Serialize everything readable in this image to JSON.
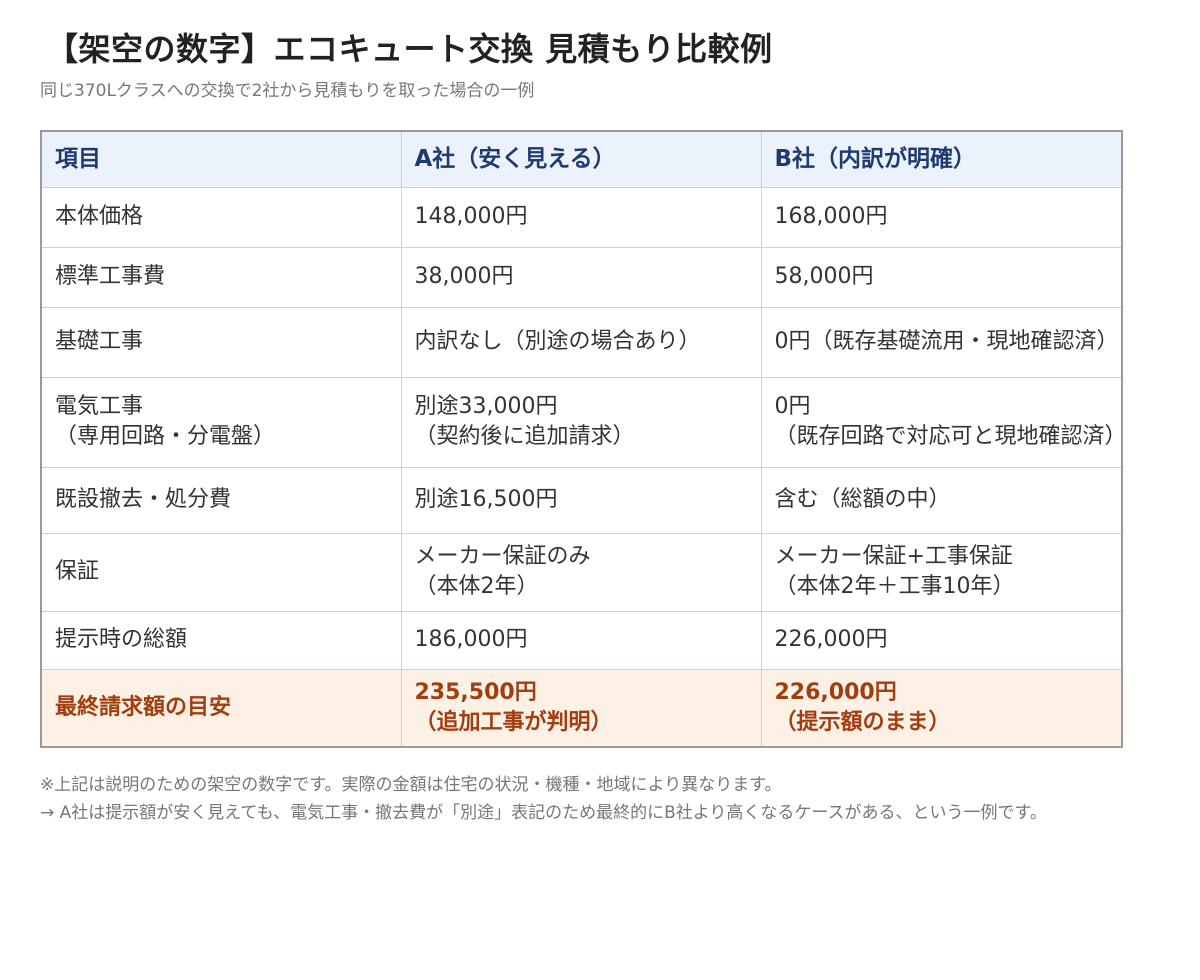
{
  "header": {
    "title": "【架空の数字】エコキュート交換 見積もり比較例",
    "subtitle": "同じ370Lクラスへの交換で2社から見積もりを取った場合の一例"
  },
  "table": {
    "columns": [
      "項目",
      "A社（安く見える）",
      "B社（内訳が明確）"
    ],
    "rows": [
      {
        "item": [
          "本体価格"
        ],
        "a": [
          "148,000円"
        ],
        "b": [
          "168,000円"
        ]
      },
      {
        "item": [
          "標準工事費"
        ],
        "a": [
          "38,000円"
        ],
        "b": [
          "58,000円"
        ]
      },
      {
        "item": [
          "基礎工事"
        ],
        "a": [
          "内訳なし（別途の場合あり）"
        ],
        "b": [
          "0円（既存基礎流用・現地確認済）"
        ]
      },
      {
        "item": [
          "電気工事",
          "（専用回路・分電盤）"
        ],
        "a": [
          "別途33,000円",
          "（契約後に追加請求）"
        ],
        "b": [
          "0円",
          "（既存回路で対応可と現地確認済）"
        ]
      },
      {
        "item": [
          "既設撤去・処分費"
        ],
        "a": [
          "別途16,500円"
        ],
        "b": [
          "含む（総額の中）"
        ]
      },
      {
        "item": [
          "保証"
        ],
        "a": [
          "メーカー保証のみ",
          "（本体2年）"
        ],
        "b": [
          "メーカー保証+工事保証",
          "（本体2年＋工事10年）"
        ]
      },
      {
        "item": [
          "提示時の総額"
        ],
        "a": [
          "186,000円"
        ],
        "b": [
          "226,000円"
        ]
      }
    ],
    "final_row": {
      "item": "最終請求額の目安",
      "a": [
        "235,500円",
        "（追加工事が判明）"
      ],
      "b": [
        "226,000円",
        "（提示額のまま）"
      ]
    }
  },
  "notes": {
    "note1": "※上記は説明のための架空の数字です。実際の金額は住宅の状況・機種・地域により異なります。",
    "note2": "→ A社は提示額が安く見えても、電気工事・撤去費が「別途」表記のため最終的にB社より高くなるケースがある、という一例です。"
  },
  "colors": {
    "header_bg": "#ebf2fc",
    "header_text": "#1f3a73",
    "final_bg": "#fdf1e5",
    "final_text": "#a23d10"
  }
}
